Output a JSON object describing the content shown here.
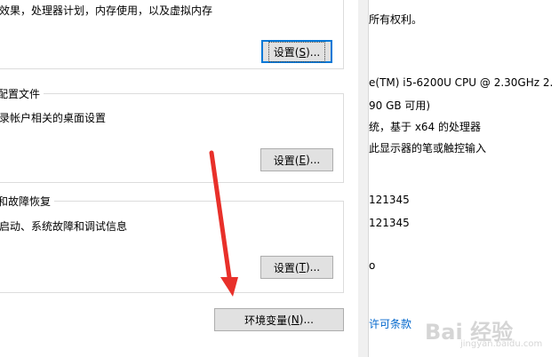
{
  "performance": {
    "desc": "效果，处理器计划，内存使用，以及虚拟内存",
    "button_pre": "设置(",
    "button_key": "S",
    "button_post": ")..."
  },
  "user_profiles": {
    "title": "配置文件",
    "desc": "录帐户相关的桌面设置",
    "button_pre": "设置(",
    "button_key": "E",
    "button_post": ")..."
  },
  "startup_recovery": {
    "title": "和故障恢复",
    "desc": "启动、系统故障和调试信息",
    "button_pre": "设置(",
    "button_key": "T",
    "button_post": ")..."
  },
  "env_button": {
    "pre": "环境变量(",
    "key": "N",
    "post": ")..."
  },
  "system_info": {
    "copyright": "所有权利。",
    "cpu": "e(TM) i5-6200U CPU @ 2.30GHz   2.",
    "ram": "90 GB 可用)",
    "type": "统，基于 x64 的处理器",
    "pen": "此显示器的笔或触控输入",
    "id1": "121345",
    "id2": "121345",
    "fragment": "o",
    "license_link": "许可条款"
  },
  "watermark": {
    "logo": "Bai 经验",
    "url": "jingyan.baidu.com"
  },
  "colors": {
    "arrow": "#e8302a",
    "focus": "#0078d7",
    "link": "#0066cc"
  }
}
